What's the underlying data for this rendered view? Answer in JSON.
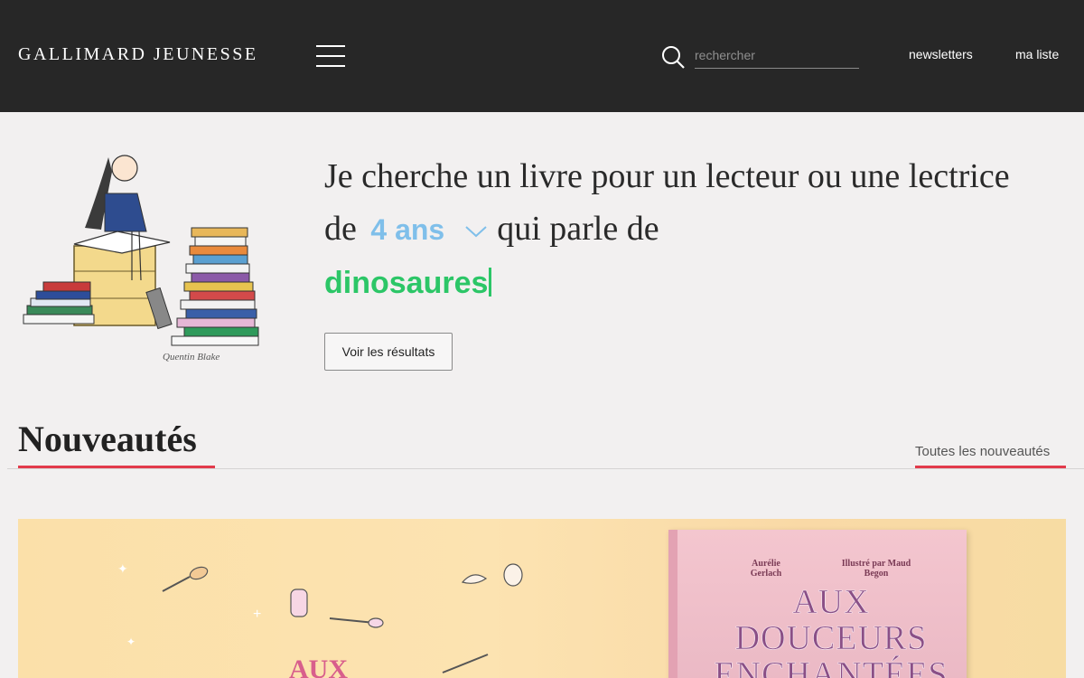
{
  "header": {
    "brand": "Gallimard Jeunesse",
    "search_placeholder": "rechercher",
    "nav": {
      "newsletters": "newsletters",
      "my_list": "ma liste"
    }
  },
  "hero": {
    "sentence_part1": "Je cherche un livre pour un lecteur ou une lectrice de",
    "age_value": "4 ans",
    "sentence_part2": "qui parle de",
    "topic_value": "dinosaures",
    "results_button": "Voir les résultats",
    "illustration_signature": "Quentin Blake"
  },
  "section": {
    "title": "Nouveautés",
    "all_link": "Toutes les nouveautés"
  },
  "banner": {
    "book_author": "Aurélie Gerlach",
    "book_illustrator": "Illustré par Maud Begon",
    "book_title": "AUX DOUCEURS ENCHANTÉES"
  },
  "colors": {
    "header_bg": "#272727",
    "age_accent": "#7fbfea",
    "topic_accent": "#2cc667",
    "underline_red": "#e23a4b"
  }
}
